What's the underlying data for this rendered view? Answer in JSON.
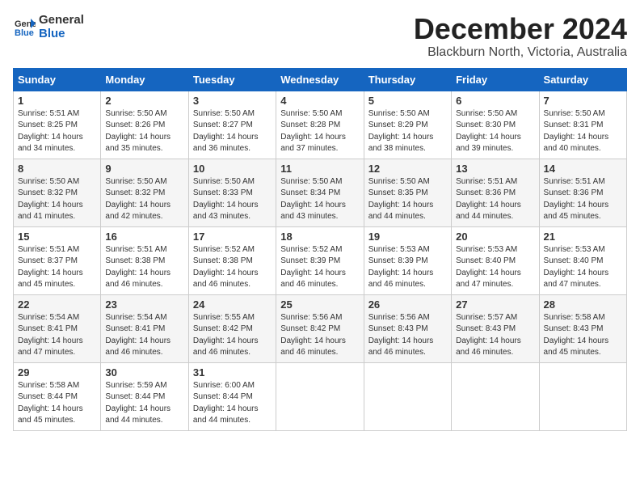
{
  "header": {
    "logo_general": "General",
    "logo_blue": "Blue",
    "month_title": "December 2024",
    "location": "Blackburn North, Victoria, Australia"
  },
  "weekdays": [
    "Sunday",
    "Monday",
    "Tuesday",
    "Wednesday",
    "Thursday",
    "Friday",
    "Saturday"
  ],
  "weeks": [
    [
      {
        "day": "1",
        "sunrise": "5:51 AM",
        "sunset": "8:25 PM",
        "daylight": "14 hours and 34 minutes."
      },
      {
        "day": "2",
        "sunrise": "5:50 AM",
        "sunset": "8:26 PM",
        "daylight": "14 hours and 35 minutes."
      },
      {
        "day": "3",
        "sunrise": "5:50 AM",
        "sunset": "8:27 PM",
        "daylight": "14 hours and 36 minutes."
      },
      {
        "day": "4",
        "sunrise": "5:50 AM",
        "sunset": "8:28 PM",
        "daylight": "14 hours and 37 minutes."
      },
      {
        "day": "5",
        "sunrise": "5:50 AM",
        "sunset": "8:29 PM",
        "daylight": "14 hours and 38 minutes."
      },
      {
        "day": "6",
        "sunrise": "5:50 AM",
        "sunset": "8:30 PM",
        "daylight": "14 hours and 39 minutes."
      },
      {
        "day": "7",
        "sunrise": "5:50 AM",
        "sunset": "8:31 PM",
        "daylight": "14 hours and 40 minutes."
      }
    ],
    [
      {
        "day": "8",
        "sunrise": "5:50 AM",
        "sunset": "8:32 PM",
        "daylight": "14 hours and 41 minutes."
      },
      {
        "day": "9",
        "sunrise": "5:50 AM",
        "sunset": "8:32 PM",
        "daylight": "14 hours and 42 minutes."
      },
      {
        "day": "10",
        "sunrise": "5:50 AM",
        "sunset": "8:33 PM",
        "daylight": "14 hours and 43 minutes."
      },
      {
        "day": "11",
        "sunrise": "5:50 AM",
        "sunset": "8:34 PM",
        "daylight": "14 hours and 43 minutes."
      },
      {
        "day": "12",
        "sunrise": "5:50 AM",
        "sunset": "8:35 PM",
        "daylight": "14 hours and 44 minutes."
      },
      {
        "day": "13",
        "sunrise": "5:51 AM",
        "sunset": "8:36 PM",
        "daylight": "14 hours and 44 minutes."
      },
      {
        "day": "14",
        "sunrise": "5:51 AM",
        "sunset": "8:36 PM",
        "daylight": "14 hours and 45 minutes."
      }
    ],
    [
      {
        "day": "15",
        "sunrise": "5:51 AM",
        "sunset": "8:37 PM",
        "daylight": "14 hours and 45 minutes."
      },
      {
        "day": "16",
        "sunrise": "5:51 AM",
        "sunset": "8:38 PM",
        "daylight": "14 hours and 46 minutes."
      },
      {
        "day": "17",
        "sunrise": "5:52 AM",
        "sunset": "8:38 PM",
        "daylight": "14 hours and 46 minutes."
      },
      {
        "day": "18",
        "sunrise": "5:52 AM",
        "sunset": "8:39 PM",
        "daylight": "14 hours and 46 minutes."
      },
      {
        "day": "19",
        "sunrise": "5:53 AM",
        "sunset": "8:39 PM",
        "daylight": "14 hours and 46 minutes."
      },
      {
        "day": "20",
        "sunrise": "5:53 AM",
        "sunset": "8:40 PM",
        "daylight": "14 hours and 47 minutes."
      },
      {
        "day": "21",
        "sunrise": "5:53 AM",
        "sunset": "8:40 PM",
        "daylight": "14 hours and 47 minutes."
      }
    ],
    [
      {
        "day": "22",
        "sunrise": "5:54 AM",
        "sunset": "8:41 PM",
        "daylight": "14 hours and 47 minutes."
      },
      {
        "day": "23",
        "sunrise": "5:54 AM",
        "sunset": "8:41 PM",
        "daylight": "14 hours and 46 minutes."
      },
      {
        "day": "24",
        "sunrise": "5:55 AM",
        "sunset": "8:42 PM",
        "daylight": "14 hours and 46 minutes."
      },
      {
        "day": "25",
        "sunrise": "5:56 AM",
        "sunset": "8:42 PM",
        "daylight": "14 hours and 46 minutes."
      },
      {
        "day": "26",
        "sunrise": "5:56 AM",
        "sunset": "8:43 PM",
        "daylight": "14 hours and 46 minutes."
      },
      {
        "day": "27",
        "sunrise": "5:57 AM",
        "sunset": "8:43 PM",
        "daylight": "14 hours and 46 minutes."
      },
      {
        "day": "28",
        "sunrise": "5:58 AM",
        "sunset": "8:43 PM",
        "daylight": "14 hours and 45 minutes."
      }
    ],
    [
      {
        "day": "29",
        "sunrise": "5:58 AM",
        "sunset": "8:44 PM",
        "daylight": "14 hours and 45 minutes."
      },
      {
        "day": "30",
        "sunrise": "5:59 AM",
        "sunset": "8:44 PM",
        "daylight": "14 hours and 44 minutes."
      },
      {
        "day": "31",
        "sunrise": "6:00 AM",
        "sunset": "8:44 PM",
        "daylight": "14 hours and 44 minutes."
      },
      null,
      null,
      null,
      null
    ]
  ]
}
